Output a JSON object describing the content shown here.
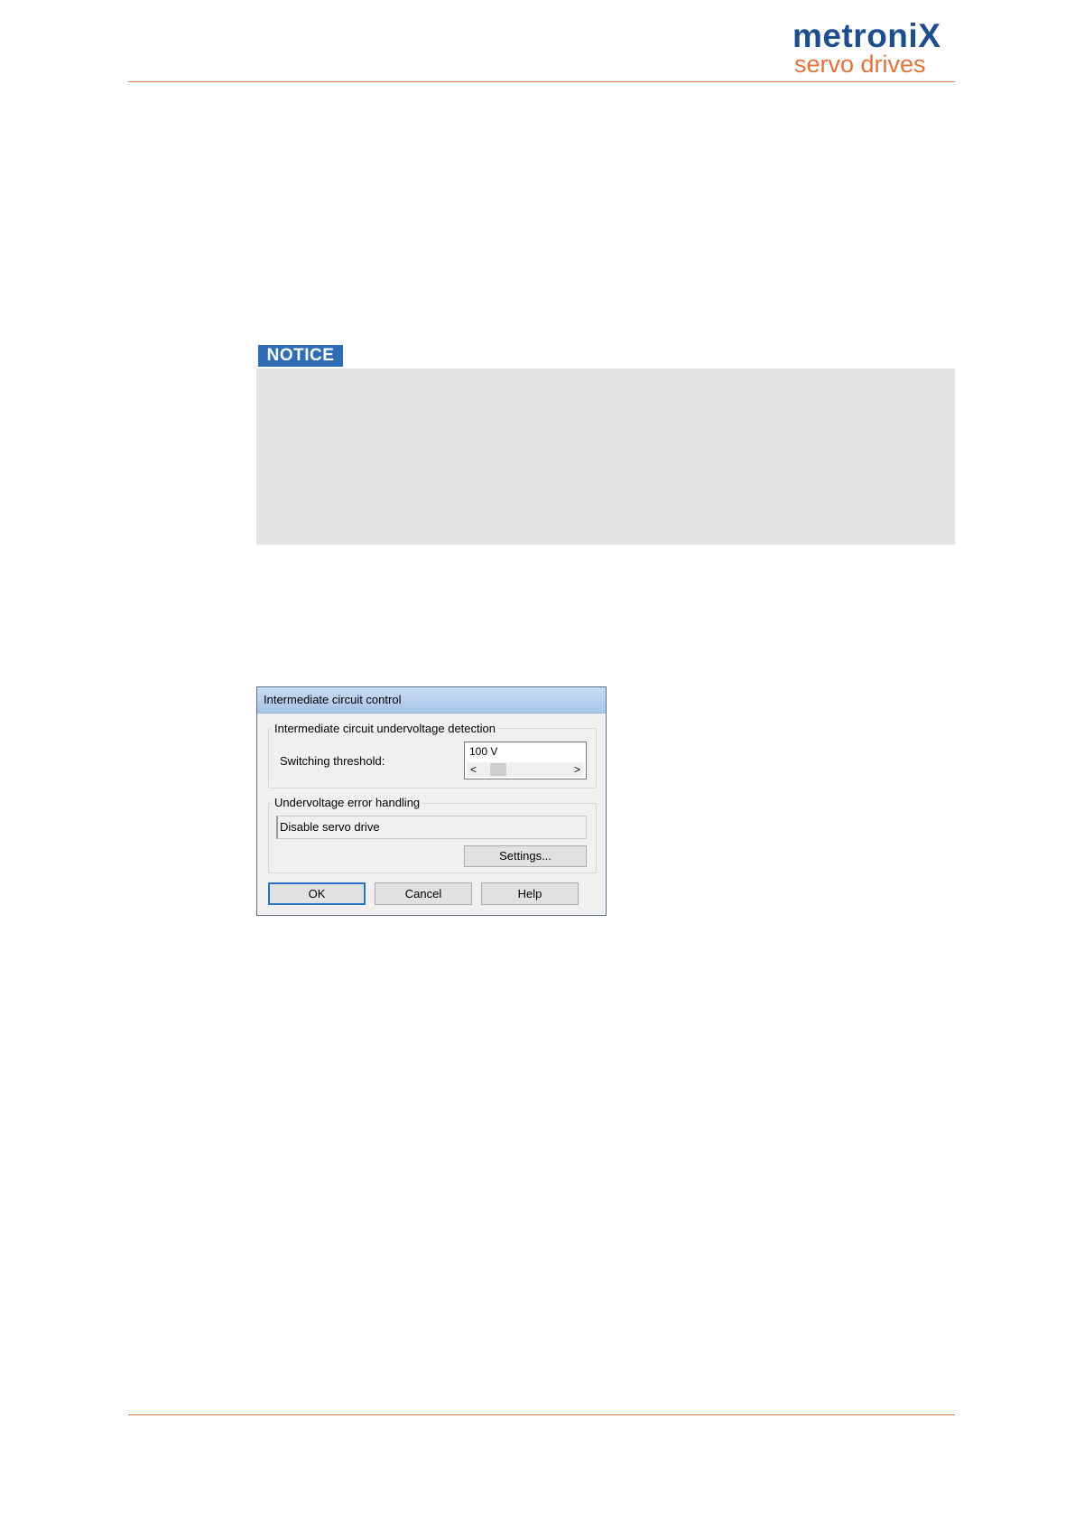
{
  "header": {
    "brand_main": "metroni",
    "brand_x": "X",
    "brand_tagline": "servo drives",
    "colors": {
      "brand_blue": "#1f4e8c",
      "brand_orange": "#e0743d",
      "rule": "#e07b4a"
    }
  },
  "notice": {
    "badge_label": "NOTICE",
    "badge_color": "#2f6db5",
    "box_color": "#e4e4e4"
  },
  "dialog": {
    "title": "Intermediate circuit control",
    "group_detection": {
      "legend": "Intermediate circuit undervoltage detection",
      "threshold_label": "Switching threshold:",
      "threshold_value": "100 V",
      "scroll_left": "<",
      "scroll_right": ">"
    },
    "group_error": {
      "legend": "Undervoltage error handling",
      "value": "Disable servo drive",
      "settings_button": "Settings..."
    },
    "buttons": {
      "ok": "OK",
      "cancel": "Cancel",
      "help": "Help"
    }
  }
}
